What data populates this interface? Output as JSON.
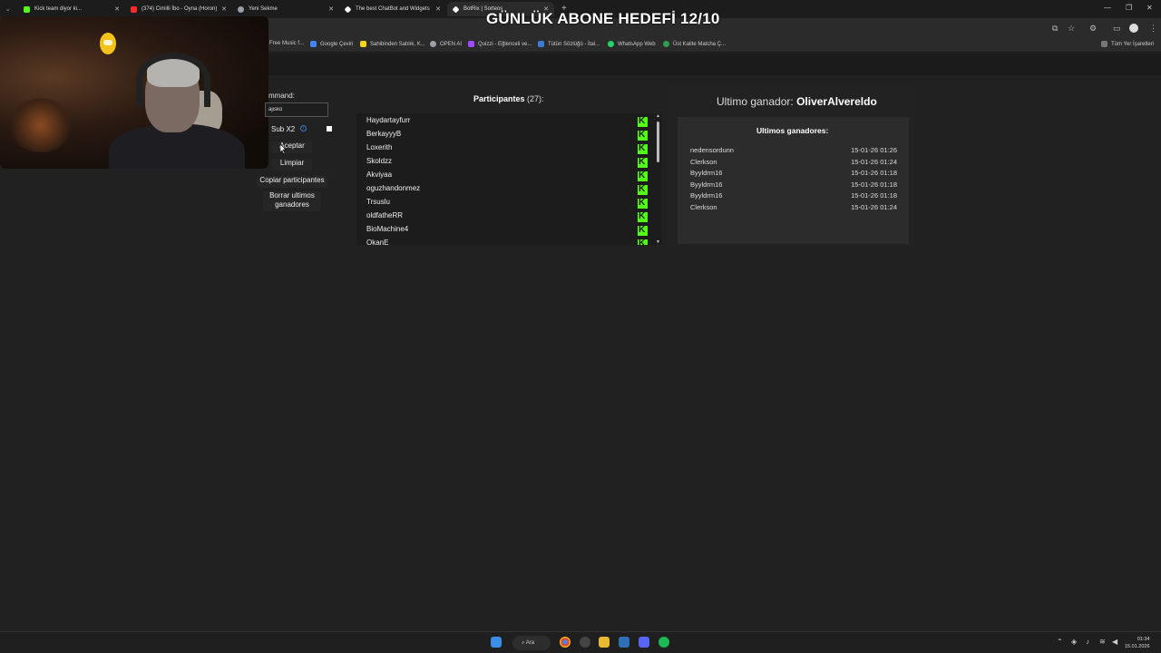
{
  "overlay": {
    "title": "GÜNLÜK ABONE HEDEFİ 12/10"
  },
  "tabs": [
    {
      "label": "Kick team diyor ki...",
      "color": "#53fc18"
    },
    {
      "label": "(374) Cimilli İbo - Oyna (Horon)",
      "color": "#ff2a2a"
    },
    {
      "label": "Yeni Sekme",
      "color": "#9aa0a6"
    },
    {
      "label": "The best ChatBot and Widgets",
      "color": "#ffffff"
    },
    {
      "label": "BotRix | Sorteos",
      "color": "#ffffff"
    }
  ],
  "bookmarks": [
    {
      "label": "Free Music f...",
      "color": "#3a7bd5"
    },
    {
      "label": "Google Çeviri",
      "color": "#4285f4"
    },
    {
      "label": "Sahibinden Satılık, K...",
      "color": "#f3d21b"
    },
    {
      "label": "OPEN AI",
      "color": "#9aa0a6"
    },
    {
      "label": "Quizzi - Eğlenceli ve...",
      "color": "#a04aff"
    },
    {
      "label": "Tütün Sözlüğü - İtal...",
      "color": "#3a7bd5"
    },
    {
      "label": "WhatsApp Web",
      "color": "#25d366"
    },
    {
      "label": "Üst Kalite Matcha Ç...",
      "color": "#2e9b4e"
    }
  ],
  "all_bookmarks_label": "Tüm Yer İşaretleri",
  "left_panel": {
    "command_label": "mmand:",
    "command_value": "ajisko",
    "sub_label": "Sub X2",
    "accept_label": "Aceptar",
    "clear_label": "Limpiar",
    "copy_label": "Copiar participantes",
    "delete_winners_label": "Borrar ultimos ganadores"
  },
  "participants": {
    "title": "Participantes",
    "count": "(27):",
    "names": [
      "Haydartayfurr",
      "BerkayyyB",
      "Loxerith",
      "Skoldzz",
      "Akviyaa",
      "oguzhandonmez",
      "Trsuslu",
      "oldfatheRR",
      "BioMachine4",
      "OkanE"
    ]
  },
  "winner": {
    "prefix": "Ultimo ganador:",
    "name": "OliverAlvereldo",
    "list_title": "Ultimos ganadores:",
    "list": [
      {
        "name": "nedensordunn",
        "date": "15-01-26 01:26"
      },
      {
        "name": "Clerkson",
        "date": "15-01-26 01:24"
      },
      {
        "name": "Byyldrm16",
        "date": "15-01-26 01:18"
      },
      {
        "name": "Byyldrm16",
        "date": "15-01-26 01:18"
      },
      {
        "name": "Byyldrm16",
        "date": "15-01-26 01:18"
      },
      {
        "name": "Clerkson",
        "date": "15-01-26 01:24"
      }
    ]
  },
  "taskbar": {
    "search_label": "Ara",
    "time": "01:34",
    "date": "15.01.2026"
  }
}
